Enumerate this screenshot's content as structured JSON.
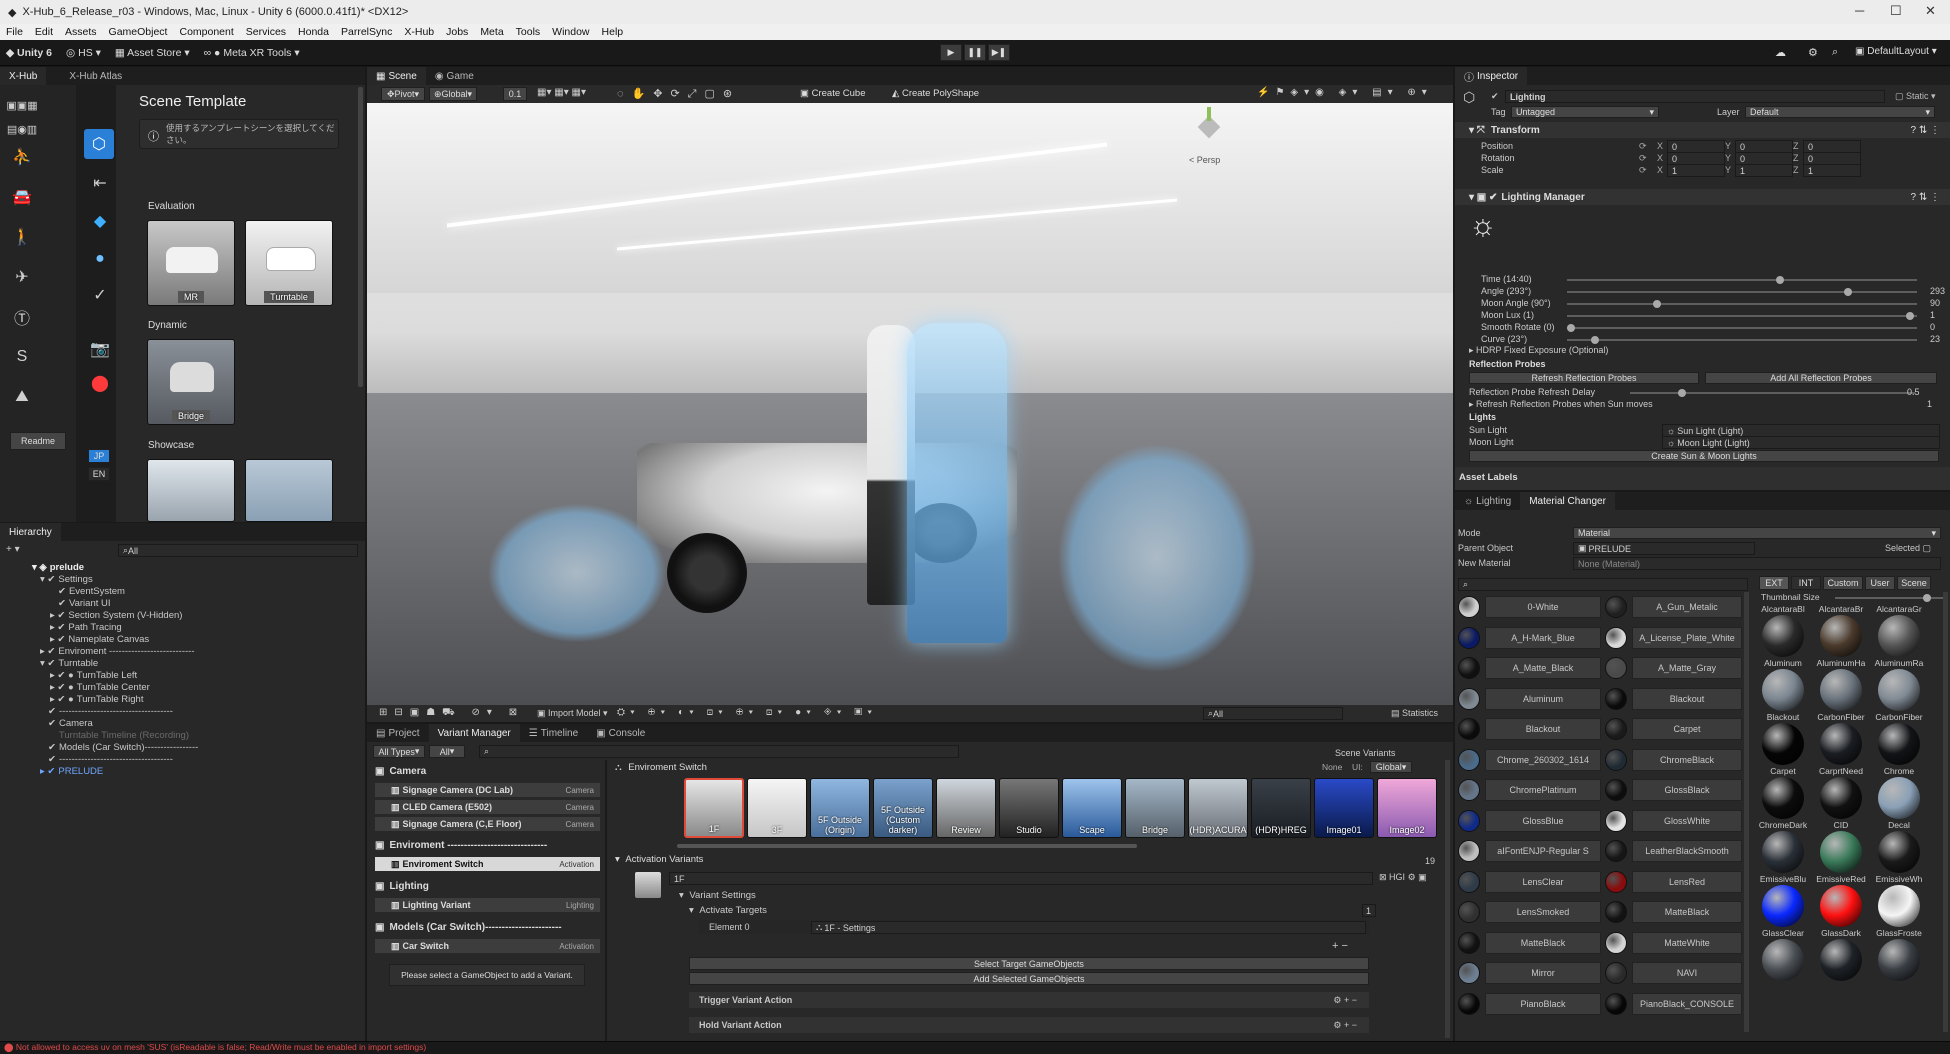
{
  "window": {
    "title": "X-Hub_6_Release_r03 - Windows, Mac, Linux - Unity 6 (6000.0.41f1)* <DX12>",
    "min": "─",
    "max": "☐",
    "close": "✕"
  },
  "menu": [
    "File",
    "Edit",
    "Assets",
    "GameObject",
    "Component",
    "Services",
    "Honda",
    "ParrelSync",
    "X-Hub",
    "Jobs",
    "Meta",
    "Tools",
    "Window",
    "Help"
  ],
  "toolbar": {
    "account": "Unity 6",
    "user": "HS",
    "asset_store": "Asset Store",
    "meta": "Meta XR Tools",
    "layout": "DefaultLayout"
  },
  "xhub": {
    "tab1": "X-Hub",
    "tab2": "X-Hub Atlas",
    "title": "Scene Template",
    "notice": "使用するアンプレートシーンを選択してください。",
    "evaluation": "Evaluation",
    "dynamic": "Dynamic",
    "showcase": "Showcase",
    "templates": {
      "mr": "MR",
      "turntable": "Turntable",
      "bridge": "Bridge"
    },
    "readme": "Readme",
    "jp": "JP",
    "en": "EN"
  },
  "hierarchy": {
    "tab": "Hierarchy",
    "search": "All",
    "root": "prelude",
    "items": [
      "Settings",
      "EventSystem",
      "Variant UI",
      "Section System (V-Hidden)",
      "Path Tracing",
      "Nameplate Canvas",
      "Enviroment ---------------------------",
      "Turntable",
      "TurnTable Left",
      "TurnTable Center",
      "TurnTable Right",
      "------------------------------------",
      "Camera",
      "Turntable Timeline (Recording)",
      "Models (Car Switch)-----------------",
      "------------------------------------",
      "PRELUDE"
    ]
  },
  "scene": {
    "tab_scene": "Scene",
    "tab_game": "Game",
    "pivot": "Pivot",
    "global": "Global",
    "snap": "0.1",
    "create_cube": "Create Cube",
    "create_polyshape": "Create PolyShape",
    "persp": "< Persp",
    "import_model": "Import Model",
    "search": "All",
    "statistics": "Statistics"
  },
  "bottom": {
    "tabs": [
      "Project",
      "Variant Manager",
      "Timeline",
      "Console"
    ],
    "types": "All Types",
    "all": "All",
    "groups": [
      {
        "name": "Camera",
        "items": [
          {
            "label": "Signage Camera (DC Lab)",
            "tag": "Camera"
          },
          {
            "label": "CLED Camera (E502)",
            "tag": "Camera"
          },
          {
            "label": "Signage Camera (C,E Floor)",
            "tag": "Camera"
          }
        ]
      },
      {
        "name": "Enviroment ------------------------------",
        "items": [
          {
            "label": "Enviroment Switch",
            "tag": "Activation"
          }
        ]
      },
      {
        "name": "Lighting",
        "items": [
          {
            "label": "Lighting Variant",
            "tag": "Lighting"
          }
        ]
      },
      {
        "name": "Models (Car Switch)-----------------------",
        "items": [
          {
            "label": "Car Switch",
            "tag": "Activation"
          }
        ]
      }
    ],
    "select_hint": "Please select a GameObject to add a Variant.",
    "env_switch": "Enviroment Switch",
    "scene_variants": "Scene Variants",
    "none": "None",
    "ui": "UI:",
    "ui_global": "Global",
    "variants": [
      "1F",
      "3F",
      "5F Outside (Origin)",
      "5F Outside (Custom darker)",
      "Review",
      "Studio",
      "Scape",
      "Bridge",
      "(HDR)ACURA",
      "(HDR)HREG",
      "Image01",
      "Image02"
    ],
    "activation_variants": "Activation Variants",
    "count": "19",
    "variant_name": "1F",
    "variant_settings": "Variant Settings",
    "activate_targets": "Activate Targets",
    "targets_count": "1",
    "element0": "Element 0",
    "element0_val": "1F - Settings",
    "select_target": "Select Target GameObjects",
    "add_selected": "Add Selected GameObjects",
    "trigger_action": "Trigger Variant Action",
    "hold_action": "Hold Variant Action",
    "hgi": "HGI"
  },
  "inspector": {
    "tab": "Inspector",
    "object": "Lighting",
    "static": "Static",
    "tag_label": "Tag",
    "tag": "Untagged",
    "layer_label": "Layer",
    "layer": "Default",
    "transform": "Transform",
    "rows": [
      {
        "label": "Position",
        "x": "0",
        "y": "0",
        "z": "0"
      },
      {
        "label": "Rotation",
        "x": "0",
        "y": "0",
        "z": "0"
      },
      {
        "label": "Scale",
        "x": "1",
        "y": "1",
        "z": "1"
      }
    ],
    "lighting_manager": "Lighting Manager",
    "sliders": [
      {
        "label": "Time (14:40)",
        "value": "",
        "pct": 0.61
      },
      {
        "label": "Angle (293°)",
        "value": "293",
        "pct": 0.81
      },
      {
        "label": "Moon Angle (90°)",
        "value": "90",
        "pct": 0.25
      },
      {
        "label": "Moon Lux (1)",
        "value": "1",
        "pct": 0.99
      },
      {
        "label": "Smooth Rotate (0)",
        "value": "0",
        "pct": 0.0
      },
      {
        "label": "Curve (23°)",
        "value": "23",
        "pct": 0.07
      }
    ],
    "hdrp": "HDRP Fixed Exposure (Optional)",
    "reflection_probes": "Reflection Probes",
    "refresh_btn": "Refresh Reflection Probes",
    "add_all_btn": "Add All Reflection Probes",
    "refresh_delay": "Reflection Probe Refresh Delay",
    "refresh_delay_val": "0.5",
    "refresh_sun": "Refresh Reflection Probes when Sun moves",
    "refresh_sun_val": "1",
    "lights": "Lights",
    "sun_light": "Sun Light",
    "sun_val": "Sun Light (Light)",
    "moon_light": "Moon Light",
    "moon_val": "Moon Light (Light)",
    "create_btn": "Create Sun & Moon Lights",
    "asset_labels": "Asset Labels"
  },
  "material": {
    "tab1": "Lighting",
    "tab2": "Material Changer",
    "mode_label": "Mode",
    "mode": "Material",
    "parent_label": "Parent Object",
    "parent": "PRELUDE",
    "selected": "Selected",
    "new_label": "New Material",
    "new": "None (Material)",
    "filters": [
      "EXT",
      "INT",
      "Custom",
      "User",
      "Scene"
    ],
    "thumb_size": "Thumbnail Size",
    "left": [
      {
        "n": "0-White",
        "c": "#cfcfcf"
      },
      {
        "n": "A_H-Mark_Blue",
        "c": "#0a1a66"
      },
      {
        "n": "A_Matte_Black",
        "c": "#101010"
      },
      {
        "n": "Aluminum",
        "c": "#7f8a93"
      },
      {
        "n": "Blackout",
        "c": "#0b0b0b"
      },
      {
        "n": "Chrome_260302_1614",
        "c": "#4a6b8a"
      },
      {
        "n": "ChromePlatinum",
        "c": "#66768a"
      },
      {
        "n": "GlossBlue",
        "c": "#102a8a"
      },
      {
        "n": "aIFontENJP-Regular S",
        "c": "#bfbfbf"
      },
      {
        "n": "LensClear",
        "c": "#2e3b48"
      },
      {
        "n": "LensSmoked",
        "c": "#303030"
      },
      {
        "n": "MatteBlack",
        "c": "#111111"
      },
      {
        "n": "Mirror",
        "c": "#6d7f92"
      },
      {
        "n": "PianoBlack",
        "c": "#070707"
      }
    ],
    "right": [
      {
        "n": "A_Gun_Metalic",
        "c": "#202020"
      },
      {
        "n": "A_License_Plate_White",
        "c": "#d8d8d8"
      },
      {
        "n": "A_Matte_Gray",
        "c": "#4a4a4a"
      },
      {
        "n": "Blackout",
        "c": "#0b0b0b"
      },
      {
        "n": "Carpet",
        "c": "#1a1a1a"
      },
      {
        "n": "ChromeBlack",
        "c": "#202a33"
      },
      {
        "n": "GlossBlack",
        "c": "#0d0d0d"
      },
      {
        "n": "GlossWhite",
        "c": "#e3e3e3"
      },
      {
        "n": "LeatherBlackSmooth",
        "c": "#161616"
      },
      {
        "n": "LensRed",
        "c": "#8a0c0c"
      },
      {
        "n": "MatteBlack",
        "c": "#121212"
      },
      {
        "n": "MatteWhite",
        "c": "#d4d4d4"
      },
      {
        "n": "NAVI",
        "c": "#2a2a2a"
      },
      {
        "n": "PianoBlack_CONSOLE",
        "c": "#060606"
      }
    ],
    "spheres": [
      {
        "n": "AlcantaraBl",
        "c": "#2a2a2a"
      },
      {
        "n": "AlcantaraBr",
        "c": "#4a3a2c"
      },
      {
        "n": "AlcantaraGr",
        "c": "#555555"
      },
      {
        "n": "Aluminum",
        "c": "#7a8590"
      },
      {
        "n": "AluminumHa",
        "c": "#6a737c"
      },
      {
        "n": "AluminumRa",
        "c": "#808a94"
      },
      {
        "n": "Blackout",
        "c": "#050505"
      },
      {
        "n": "CarbonFiber",
        "c": "#1a1d22"
      },
      {
        "n": "CarbonFiber",
        "c": "#121417"
      },
      {
        "n": "Carpet",
        "c": "#0c0c0c"
      },
      {
        "n": "CarprtNeed",
        "c": "#111111"
      },
      {
        "n": "Chrome",
        "c": "#8aa0b6"
      },
      {
        "n": "ChromeDark",
        "c": "#2a3038"
      },
      {
        "n": "CID",
        "c": "#3a7a5a"
      },
      {
        "n": "Decal",
        "c": "#1a1a1a"
      },
      {
        "n": "EmissiveBlu",
        "c": "#0a28ff"
      },
      {
        "n": "EmissiveRed",
        "c": "#ff1010"
      },
      {
        "n": "EmissiveWh",
        "c": "#f5f5f5"
      },
      {
        "n": "GlassClear",
        "c": "#4a4f55"
      },
      {
        "n": "GlassDark",
        "c": "#1e2227"
      },
      {
        "n": "GlassFroste",
        "c": "#3a3f45"
      }
    ]
  },
  "status": {
    "message": "Not allowed to access uv on mesh 'SUS' (isReadable is false; Read/Write must be enabled in import settings)"
  }
}
